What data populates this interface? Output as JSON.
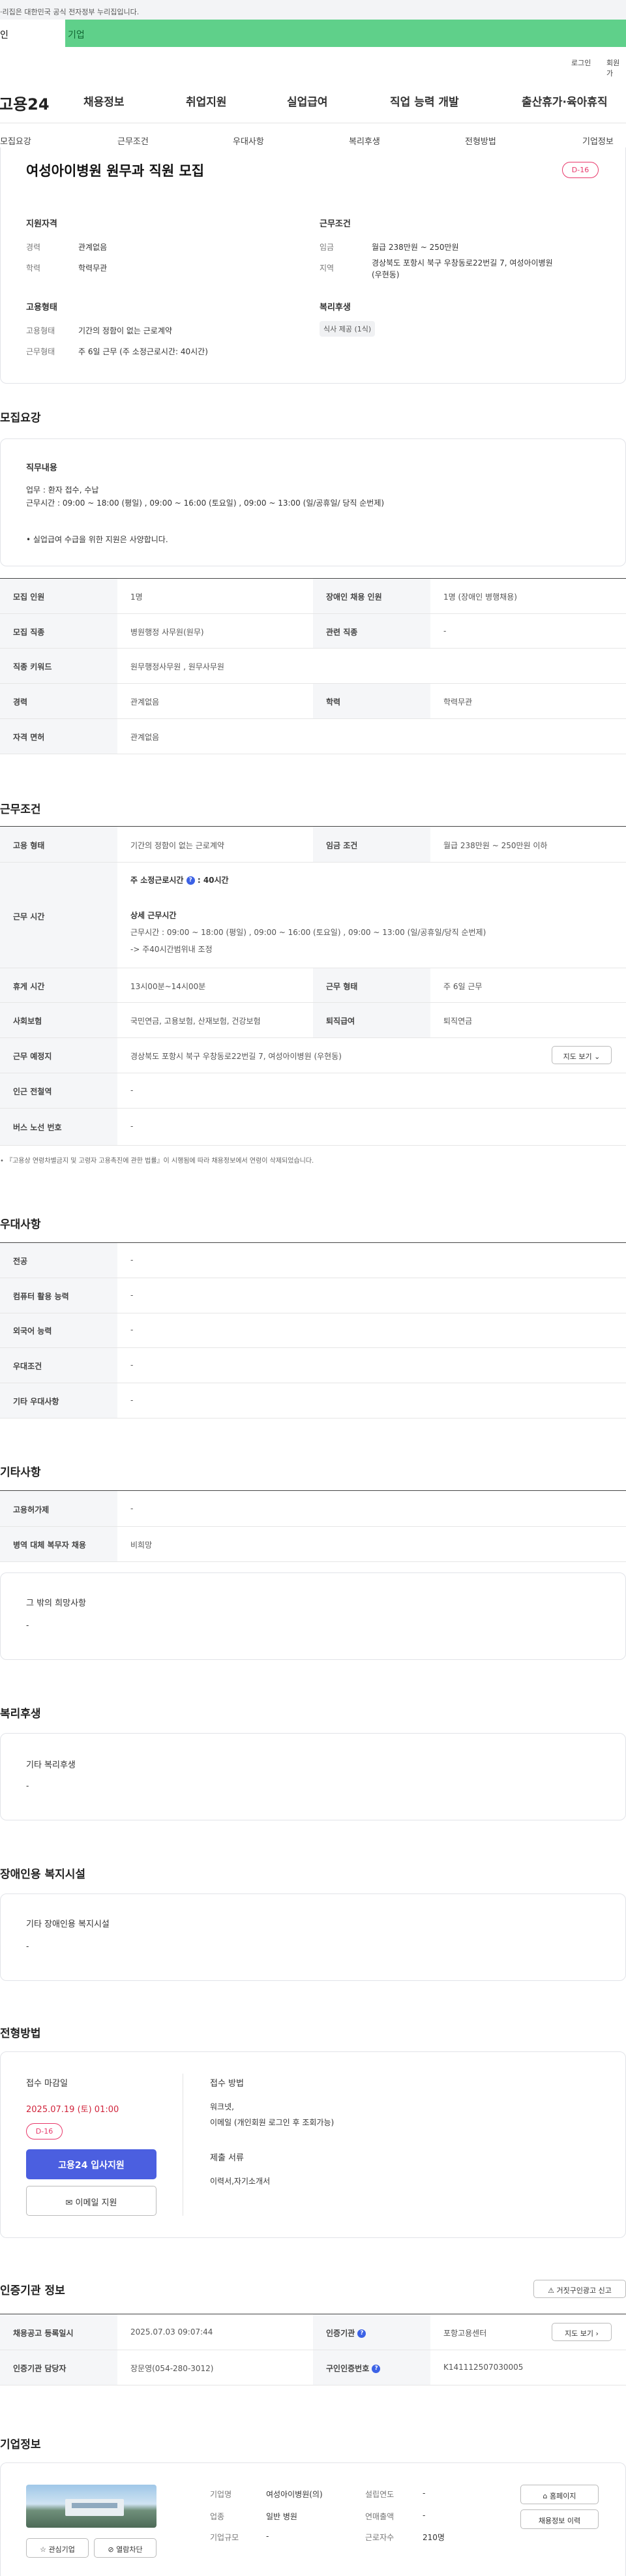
{
  "gov_banner": "·리집은 대한민국 공식 전자정부 누리집입니다.",
  "site_tabs": [
    "인",
    "기업"
  ],
  "util_links": [
    "로그인",
    "회원가"
  ],
  "logo": "고용24",
  "gnb": [
    "채용정보",
    "취업지원",
    "실업급여",
    "직업 능력 개발",
    "출산휴가·육아휴직"
  ],
  "lnb": [
    "모집요강",
    "근무조건",
    "우대사항",
    "복리후생",
    "전형방법",
    "기업정보"
  ],
  "summary": {
    "title": "여성아이병원 원무과 직원 모집",
    "dday": "D-16",
    "qual_title": "지원자격",
    "career_label": "경력",
    "career_value": "관계없음",
    "edu_label": "학력",
    "edu_value": "학력무관",
    "cond_title": "근무조건",
    "wage_label": "임금",
    "wage_value": "월급 238만원 ~ 250만원",
    "region_label": "지역",
    "region_value_1": "경상북도 포항시 북구 우창동로22번길 7, 여성아이병원",
    "region_value_2": "(우현동)",
    "emp_title": "고용형태",
    "emp_type_label": "고용형태",
    "emp_type_value": "기간의 정함이 없는 근로계약",
    "work_type_label": "근무형태",
    "work_type_value": "주 6일 근무 (주 소정근로시간: 40시간)",
    "welfare_title": "복리후생",
    "welfare_chip": "식사 제공 (1식)"
  },
  "recruit": {
    "heading": "모집요강",
    "duty_title": "직무내용",
    "duty_line1": "업무 :  환자 접수, 수납",
    "duty_line2": "근무시간 : 09:00 ~ 18:00 (평일) , 09:00 ~ 16:00 (토요일) , 09:00  ~ 13:00 (일/공휴일/ 당직 순번제)",
    "duty_note": "• 실업급여 수급을 위한 지원은 사양합니다.",
    "rows": [
      {
        "l1": "모집 인원",
        "v1": "1명",
        "l2": "장애인 채용 인원",
        "v2": "1명 (장애인 병행채용)"
      },
      {
        "l1": "모집 직종",
        "v1": "병원행정 사무원(원무)",
        "l2": "관련 직종",
        "v2": "-"
      },
      {
        "l1": "직종 키워드",
        "v1": "원무행정사무원 , 원무사무원"
      },
      {
        "l1": "경력",
        "v1": "관계없음",
        "l2": "학력",
        "v2": "학력무관"
      },
      {
        "l1": "자격 면허",
        "v1": "관계없음"
      }
    ]
  },
  "conditions": {
    "heading": "근무조건",
    "emp_label": "고용 형태",
    "emp_value": "기간의 정함이 없는 근로계약",
    "wage_label": "임금 조건",
    "wage_value": "월급 238만원 ~ 250만원 이하",
    "hours_label": "근무 시간",
    "hours_main": "주 소정근로시간",
    "hours_main_value": ": 40시간",
    "hours_detail_title": "상세 근무시간",
    "hours_detail_1": "근무시간 : 09:00 ~ 18:00 (평일) , 09:00 ~ 16:00 (토요일) , 09:00  ~ 13:00 (일/공휴일/당직 순번제)",
    "hours_detail_2": "-> 주40시간범위내 조정",
    "break_label": "휴게 시간",
    "break_value": "13시00분~14시00분",
    "worktype_label": "근무 형태",
    "worktype_value": "주 6일 근무",
    "insurance_label": "사회보험",
    "insurance_value": "국민연금, 고용보험, 산재보험, 건강보험",
    "retire_label": "퇴직급여",
    "retire_value": "퇴직연금",
    "place_label": "근무 예정지",
    "place_value": "경상북도 포항시 북구 우창동로22번길 7, 여성아이병원 (우현동)",
    "map_btn": "지도 보기",
    "station_label": "인근 전철역",
    "station_value": "-",
    "bus_label": "버스 노선 번호",
    "bus_value": "-",
    "footnote": "『고용상 연령차별금지 및 고령자 고용촉진에 관한 법률』이 시행됨에 따라 채용정보에서 연령이 삭제되었습니다."
  },
  "preference": {
    "heading": "우대사항",
    "rows": [
      {
        "l": "전공",
        "v": "-"
      },
      {
        "l": "컴퓨터 활용 능력",
        "v": "-"
      },
      {
        "l": "외국어 능력",
        "v": "-"
      },
      {
        "l": "우대조건",
        "v": "-"
      },
      {
        "l": "기타 우대사항",
        "v": "-"
      }
    ]
  },
  "etc": {
    "heading": "기타사항",
    "rows": [
      {
        "l": "고용허가제",
        "v": "-"
      },
      {
        "l": "병역 대체 복무자 채용",
        "v": "비희망"
      }
    ],
    "box_title": "그 밖의 희망사항",
    "box_value": "-"
  },
  "welfare": {
    "heading": "복리후생",
    "box_title": "기타 복리후생",
    "box_value": "-"
  },
  "disabled": {
    "heading": "장애인용 복지시설",
    "box_title": "기타 장애인용 복지시설",
    "box_value": "-"
  },
  "process": {
    "heading": "전형방법",
    "deadline_title": "접수 마감일",
    "deadline_value": "2025.07.19 (토) 01:00",
    "dday": "D-16",
    "apply_btn": "고용24 입사지원",
    "email_btn": "이메일 지원",
    "method_title": "접수 방법",
    "method_1": "워크넷,",
    "method_2": "이메일 (개인회원 로그인 후 조회가능)",
    "docs_title": "제출 서류",
    "docs_value": "이력서,자기소개서"
  },
  "cert": {
    "heading": "인증기관 정보",
    "report_btn": "거짓구인광고 신고",
    "reg_label": "채용공고 등록일시",
    "reg_value": "2025.07.03 09:07:44",
    "agency_label": "인증기관",
    "agency_value": "포항고용센터",
    "map_btn": "지도 보기",
    "manager_label": "인증기관 담당자",
    "manager_value": "장문영(054-280-3012)",
    "number_label": "구인인증번호",
    "number_value": "K141112507030005"
  },
  "company": {
    "heading": "기업정보",
    "name_label": "기업명",
    "name_value": "여성아이병원(의)",
    "year_label": "설립연도",
    "year_value": "-",
    "industry_label": "업종",
    "industry_value": "일반 병원",
    "sales_label": "연매출액",
    "sales_value": "-",
    "size_label": "기업규모",
    "size_value": "-",
    "workers_label": "근로자수",
    "workers_value": "210명",
    "home_btn": "홈페이지",
    "history_btn": "채용정보 이력",
    "fav_btn": "관심기업",
    "block_btn": "열람차단"
  }
}
